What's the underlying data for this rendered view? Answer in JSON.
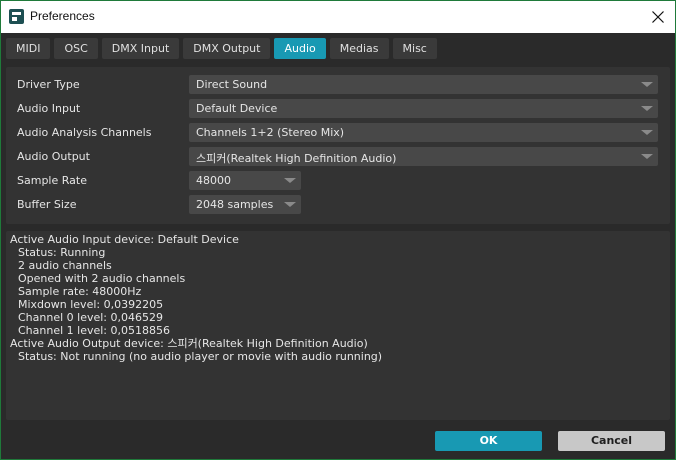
{
  "window": {
    "title": "Preferences",
    "close_icon": "close-icon",
    "app_icon": "app-icon"
  },
  "tabs": [
    {
      "label": "MIDI",
      "active": false
    },
    {
      "label": "OSC",
      "active": false
    },
    {
      "label": "DMX Input",
      "active": false
    },
    {
      "label": "DMX Output",
      "active": false
    },
    {
      "label": "Audio",
      "active": true
    },
    {
      "label": "Medias",
      "active": false
    },
    {
      "label": "Misc",
      "active": false
    }
  ],
  "settings": {
    "driver_type": {
      "label": "Driver Type",
      "value": "Direct Sound"
    },
    "audio_input": {
      "label": "Audio Input",
      "value": "Default Device"
    },
    "analysis_channels": {
      "label": "Audio Analysis Channels",
      "value": "Channels 1+2 (Stereo Mix)"
    },
    "audio_output": {
      "label": "Audio Output",
      "value": "스피커(Realtek High Definition Audio)"
    },
    "sample_rate": {
      "label": "Sample Rate",
      "value": "48000"
    },
    "buffer_size": {
      "label": "Buffer Size",
      "value": "2048 samples"
    }
  },
  "log": {
    "lines": [
      "Active Audio Input device: Default Device",
      "Status: Running",
      "2 audio channels",
      "Opened with 2 audio channels",
      "Sample rate: 48000Hz",
      "Mixdown level: 0,0392205",
      "Channel 0 level: 0,046529",
      "Channel 1 level: 0,0518856",
      "Active Audio Output device: 스피커(Realtek High Definition Audio)",
      "Status: Not running (no audio player or movie with audio running)"
    ]
  },
  "buttons": {
    "ok_label": "OK",
    "cancel_label": "Cancel"
  },
  "colors": {
    "accent": "#1899b3",
    "background": "#2a2a2a",
    "panel": "#333333",
    "field": "#484848"
  }
}
